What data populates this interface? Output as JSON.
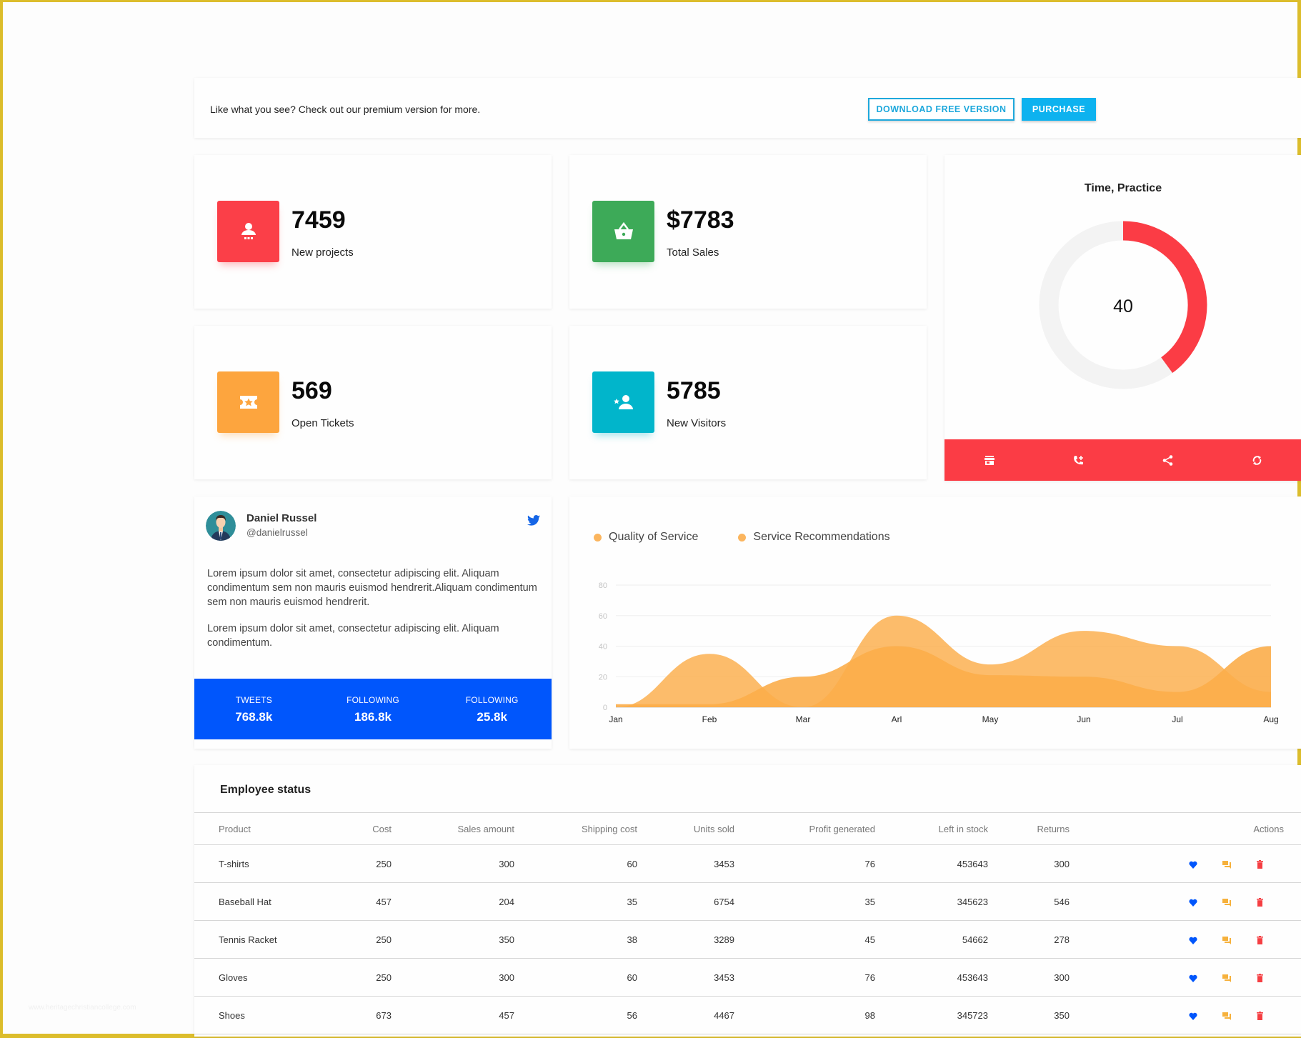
{
  "banner": {
    "message": "Like what you see? Check out our premium version for more.",
    "download_label": "DOWNLOAD FREE VERSION",
    "purchase_label": "PURCHASE"
  },
  "stats": [
    {
      "value": "7459",
      "label": "New projects",
      "icon": "user-presentation-icon",
      "color": "#fb3f48"
    },
    {
      "value": "$7783",
      "label": "Total Sales",
      "icon": "shopping-basket-icon",
      "color": "#3daa58"
    },
    {
      "value": "569",
      "label": "Open Tickets",
      "icon": "ticket-star-icon",
      "color": "#fda53e"
    },
    {
      "value": "5785",
      "label": "New Visitors",
      "icon": "person-star-icon",
      "color": "#01b5cb"
    }
  ],
  "donut": {
    "title": "Time, Practice",
    "value": 40,
    "max": 100,
    "value_label": "40",
    "color": "#fb3c45",
    "track_color": "#f3f3f3",
    "footer_icons": [
      "store-icon",
      "phone-add-icon",
      "share-icon",
      "refresh-icon"
    ]
  },
  "twitter": {
    "name": "Daniel Russel",
    "handle": "@danielrussel",
    "paragraphs": [
      "Lorem ipsum dolor sit amet, consectetur adipiscing elit. Aliquam condimentum sem non mauris euismod hendrerit.Aliquam condimentum sem non mauris euismod hendrerit.",
      "Lorem ipsum dolor sit amet, consectetur adipiscing elit. Aliquam condimentum."
    ],
    "stats": [
      {
        "label": "TWEETS",
        "value": "768.8k"
      },
      {
        "label": "FOLLOWING",
        "value": "186.8k"
      },
      {
        "label": "FOLLOWING",
        "value": "25.8k"
      }
    ],
    "band_color": "#0056fc"
  },
  "chart_data": {
    "type": "area",
    "title": "",
    "xlabel": "",
    "ylabel": "",
    "categories": [
      "Jan",
      "Feb",
      "Mar",
      "Arl",
      "May",
      "Jun",
      "Jul",
      "Aug"
    ],
    "ylim": [
      0,
      80
    ],
    "yticks": [
      0,
      20,
      40,
      60,
      80
    ],
    "grid": true,
    "legend": "top-left",
    "series": [
      {
        "name": "Quality of Service",
        "values": [
          0,
          35,
          0,
          60,
          28,
          50,
          40,
          10
        ],
        "color": "#fbad4a"
      },
      {
        "name": "Service Recommendations",
        "values": [
          2,
          2,
          20,
          40,
          21,
          20,
          10,
          40
        ],
        "color": "#fbad4a"
      }
    ]
  },
  "table": {
    "title": "Employee status",
    "columns": [
      "Product",
      "Cost",
      "Sales amount",
      "Shipping cost",
      "Units sold",
      "Profit generated",
      "Left in stock",
      "Returns",
      "Actions"
    ],
    "rows": [
      [
        "T-shirts",
        "250",
        "300",
        "60",
        "3453",
        "76",
        "453643",
        "300"
      ],
      [
        "Baseball Hat",
        "457",
        "204",
        "35",
        "6754",
        "35",
        "345623",
        "546"
      ],
      [
        "Tennis Racket",
        "250",
        "350",
        "38",
        "3289",
        "45",
        "54662",
        "278"
      ],
      [
        "Gloves",
        "250",
        "300",
        "60",
        "3453",
        "76",
        "453643",
        "300"
      ],
      [
        "Shoes",
        "673",
        "457",
        "56",
        "4467",
        "98",
        "345723",
        "350"
      ]
    ],
    "actions": [
      "favorite-icon",
      "comments-icon",
      "delete-icon"
    ]
  },
  "watermark": "www.heritagechristiancollege.com"
}
